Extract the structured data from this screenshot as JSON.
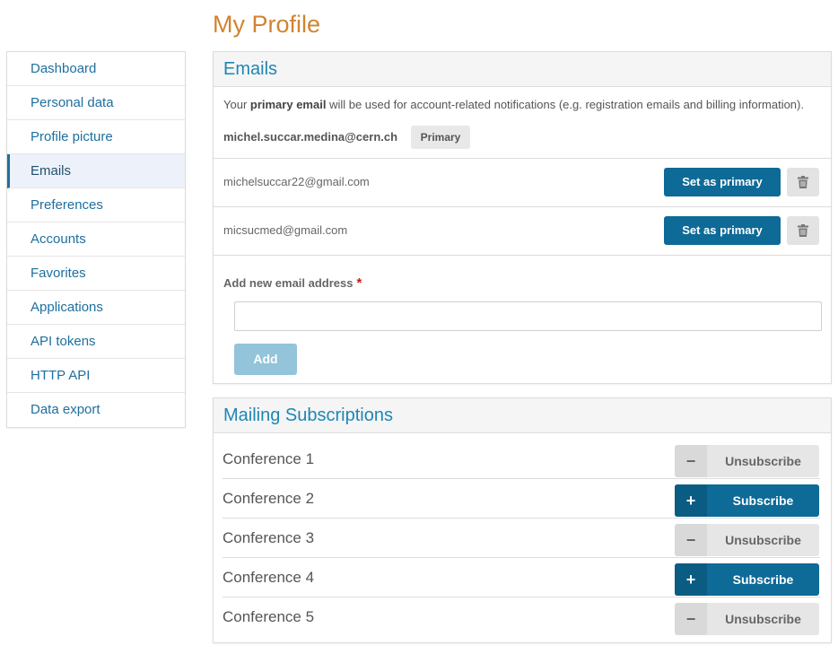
{
  "page": {
    "title": "My Profile"
  },
  "sidebar": {
    "items": [
      {
        "label": "Dashboard"
      },
      {
        "label": "Personal data"
      },
      {
        "label": "Profile picture"
      },
      {
        "label": "Emails",
        "active": true
      },
      {
        "label": "Preferences"
      },
      {
        "label": "Accounts"
      },
      {
        "label": "Favorites"
      },
      {
        "label": "Applications"
      },
      {
        "label": "API tokens"
      },
      {
        "label": "HTTP API"
      },
      {
        "label": "Data export"
      }
    ]
  },
  "emails": {
    "heading": "Emails",
    "intro_before": "Your ",
    "intro_bold": "primary email",
    "intro_after": " will be used for account-related notifications (e.g. registration emails and billing information).",
    "primary_email": "michel.succar.medina@cern.ch",
    "primary_badge": "Primary",
    "secondary": [
      {
        "address": "michelsuccar22@gmail.com",
        "set_primary_label": "Set as primary"
      },
      {
        "address": "micsucmed@gmail.com",
        "set_primary_label": "Set as primary"
      }
    ],
    "add_label": "Add new email address",
    "add_required_mark": "*",
    "add_input_value": "",
    "add_button": "Add"
  },
  "mailing": {
    "heading": "Mailing Subscriptions",
    "items": [
      {
        "name": "Conference 1",
        "action": "Unsubscribe",
        "icon": "−"
      },
      {
        "name": "Conference 2",
        "action": "Subscribe",
        "icon": "+"
      },
      {
        "name": "Conference 3",
        "action": "Unsubscribe",
        "icon": "−"
      },
      {
        "name": "Conference 4",
        "action": "Subscribe",
        "icon": "+"
      },
      {
        "name": "Conference 5",
        "action": "Unsubscribe",
        "icon": "−"
      }
    ]
  },
  "colors": {
    "title": "#d2832f",
    "link": "#1e6f9e",
    "heading": "#1f86b5",
    "primary_button": "#0e6a96",
    "add_button_disabled": "#93c4d9",
    "required": "#c21b1b"
  },
  "icons": {
    "delete": "trash-icon",
    "subscribe": "plus-icon",
    "unsubscribe": "minus-icon"
  }
}
